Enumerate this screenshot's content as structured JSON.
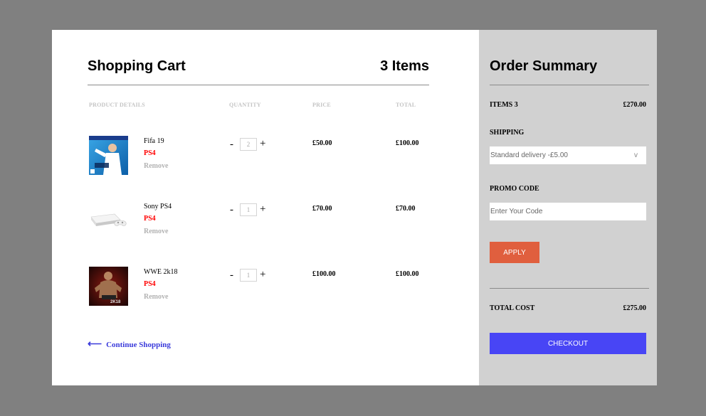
{
  "cart": {
    "title": "Shopping Cart",
    "item_count": "3 Items",
    "columns": {
      "product": "PRODUCT DETAILS",
      "quantity": "QUANTITY",
      "price": "PRICE",
      "total": "TOTAL"
    },
    "items": [
      {
        "name": "Fifa 19",
        "platform": "PS4",
        "remove": "Remove",
        "minus": "-",
        "plus": "+",
        "quantity": "2",
        "price": "£50.00",
        "total": "£100.00"
      },
      {
        "name": "Sony PS4",
        "platform": "PS4",
        "remove": "Remove",
        "minus": "-",
        "plus": "+",
        "quantity": "1",
        "price": "£70.00",
        "total": "£70.00"
      },
      {
        "name": "WWE 2k18",
        "platform": "PS4",
        "remove": "Remove",
        "minus": "-",
        "plus": "+",
        "quantity": "1",
        "price": "£100.00",
        "total": "£100.00"
      }
    ],
    "continue_arrow": "⟵",
    "continue_label": "Continue Shopping"
  },
  "summary": {
    "title": "Order Summary",
    "items_label": "ITEMS 3",
    "items_value": "£270.00",
    "shipping_label": "SHIPPING",
    "shipping_selected": "Standard delivery -£5.00",
    "shipping_chevron": "v",
    "promo_label": "PROMO CODE",
    "promo_placeholder": "Enter Your Code",
    "apply_label": "APPLY",
    "total_label": "TOTAL COST",
    "total_value": "£275.00",
    "checkout_label": "CHECKOUT"
  },
  "colors": {
    "backdrop": "#808080",
    "summary_bg": "#d1d1d1",
    "platform_red": "#ff0000",
    "apply_orange": "#e05f3e",
    "checkout_blue": "#4845f5",
    "link_blue": "#3b3bdb"
  },
  "icons": {
    "back_arrow": "left-arrow-icon",
    "select_chevron": "chevron-down-icon"
  }
}
